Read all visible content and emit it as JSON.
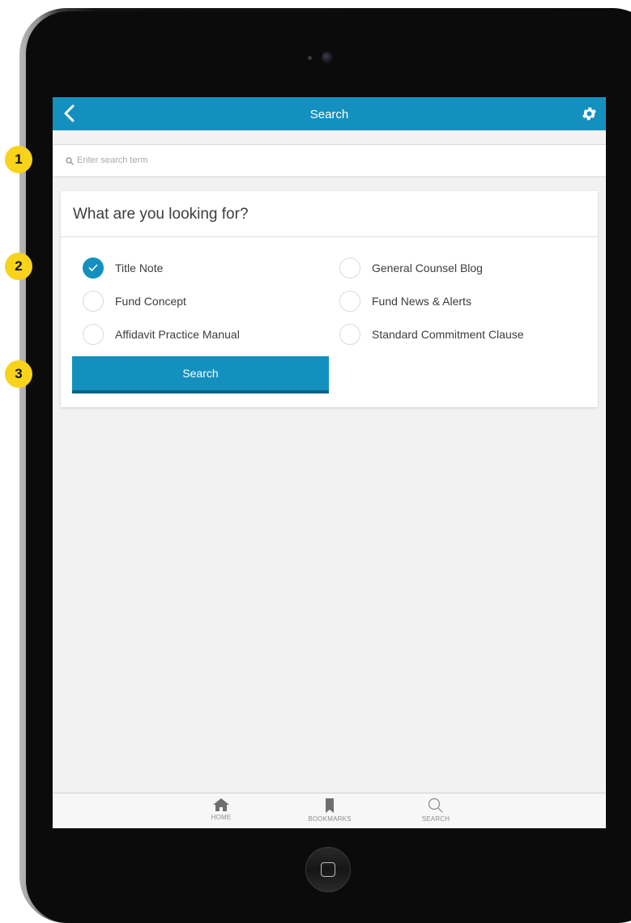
{
  "navbar": {
    "title": "Search"
  },
  "search": {
    "placeholder": "Enter search term"
  },
  "card": {
    "heading": "What are you looking for?",
    "options": [
      {
        "label": "Title Note",
        "checked": true
      },
      {
        "label": "General Counsel Blog",
        "checked": false
      },
      {
        "label": "Fund Concept",
        "checked": false
      },
      {
        "label": "Fund News & Alerts",
        "checked": false
      },
      {
        "label": "Affidavit Practice Manual",
        "checked": false
      },
      {
        "label": "Standard Commitment Clause",
        "checked": false
      }
    ],
    "button_label": "Search"
  },
  "tabbar": {
    "items": [
      {
        "label": "HOME",
        "icon": "home-icon"
      },
      {
        "label": "BOOKMARKS",
        "icon": "bookmark-icon"
      },
      {
        "label": "SEARCH",
        "icon": "search-icon"
      }
    ]
  },
  "annotations": [
    "1",
    "2",
    "3"
  ],
  "colors": {
    "accent": "#1490bf",
    "accent_dark": "#0d6384",
    "badge": "#f8d31a"
  }
}
